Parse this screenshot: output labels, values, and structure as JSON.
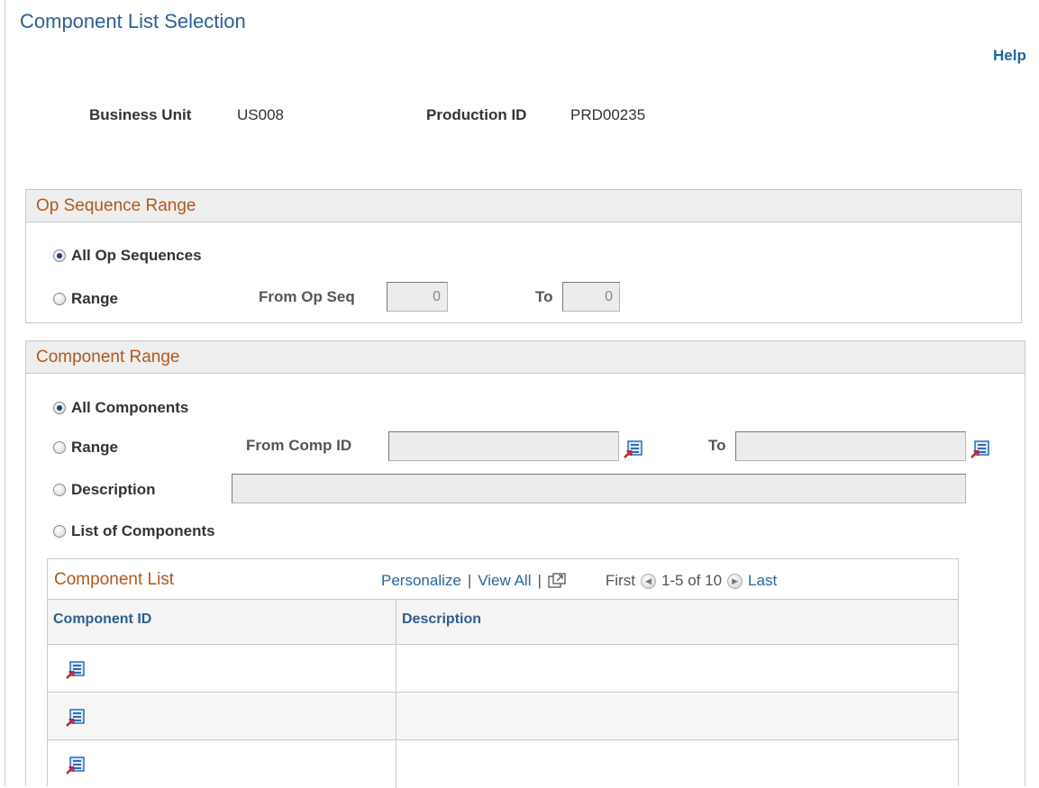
{
  "page": {
    "title": "Component List Selection",
    "help": "Help"
  },
  "header": {
    "business_unit_label": "Business Unit",
    "business_unit_value": "US008",
    "production_id_label": "Production ID",
    "production_id_value": "PRD00235"
  },
  "op_sequence": {
    "title": "Op Sequence Range",
    "all_label": "All Op Sequences",
    "range_label": "Range",
    "from_label": "From Op Seq",
    "from_value": "0",
    "to_label": "To",
    "to_value": "0",
    "selected": "all"
  },
  "component_range": {
    "title": "Component Range",
    "all_label": "All Components",
    "range_label": "Range",
    "from_label": "From Comp ID",
    "from_value": "",
    "to_label": "To",
    "to_value": "",
    "description_label": "Description",
    "description_value": "",
    "list_label": "List of Components",
    "selected": "all"
  },
  "component_list": {
    "title": "Component List",
    "personalize": "Personalize",
    "view_all": "View All",
    "first": "First",
    "range_text": "1-5 of 10",
    "last": "Last",
    "columns": [
      "Component ID",
      "Description"
    ],
    "rows": [
      {
        "component_id": "",
        "description": ""
      },
      {
        "component_id": "",
        "description": ""
      },
      {
        "component_id": "",
        "description": ""
      }
    ]
  },
  "icons": {
    "lookup": "lookup-icon",
    "new_window": "new-window-icon",
    "prev": "previous-arrow-icon",
    "next": "next-arrow-icon"
  },
  "colors": {
    "link": "#23669f",
    "section_title": "#b2591d",
    "page_title": "#2b5f93"
  }
}
